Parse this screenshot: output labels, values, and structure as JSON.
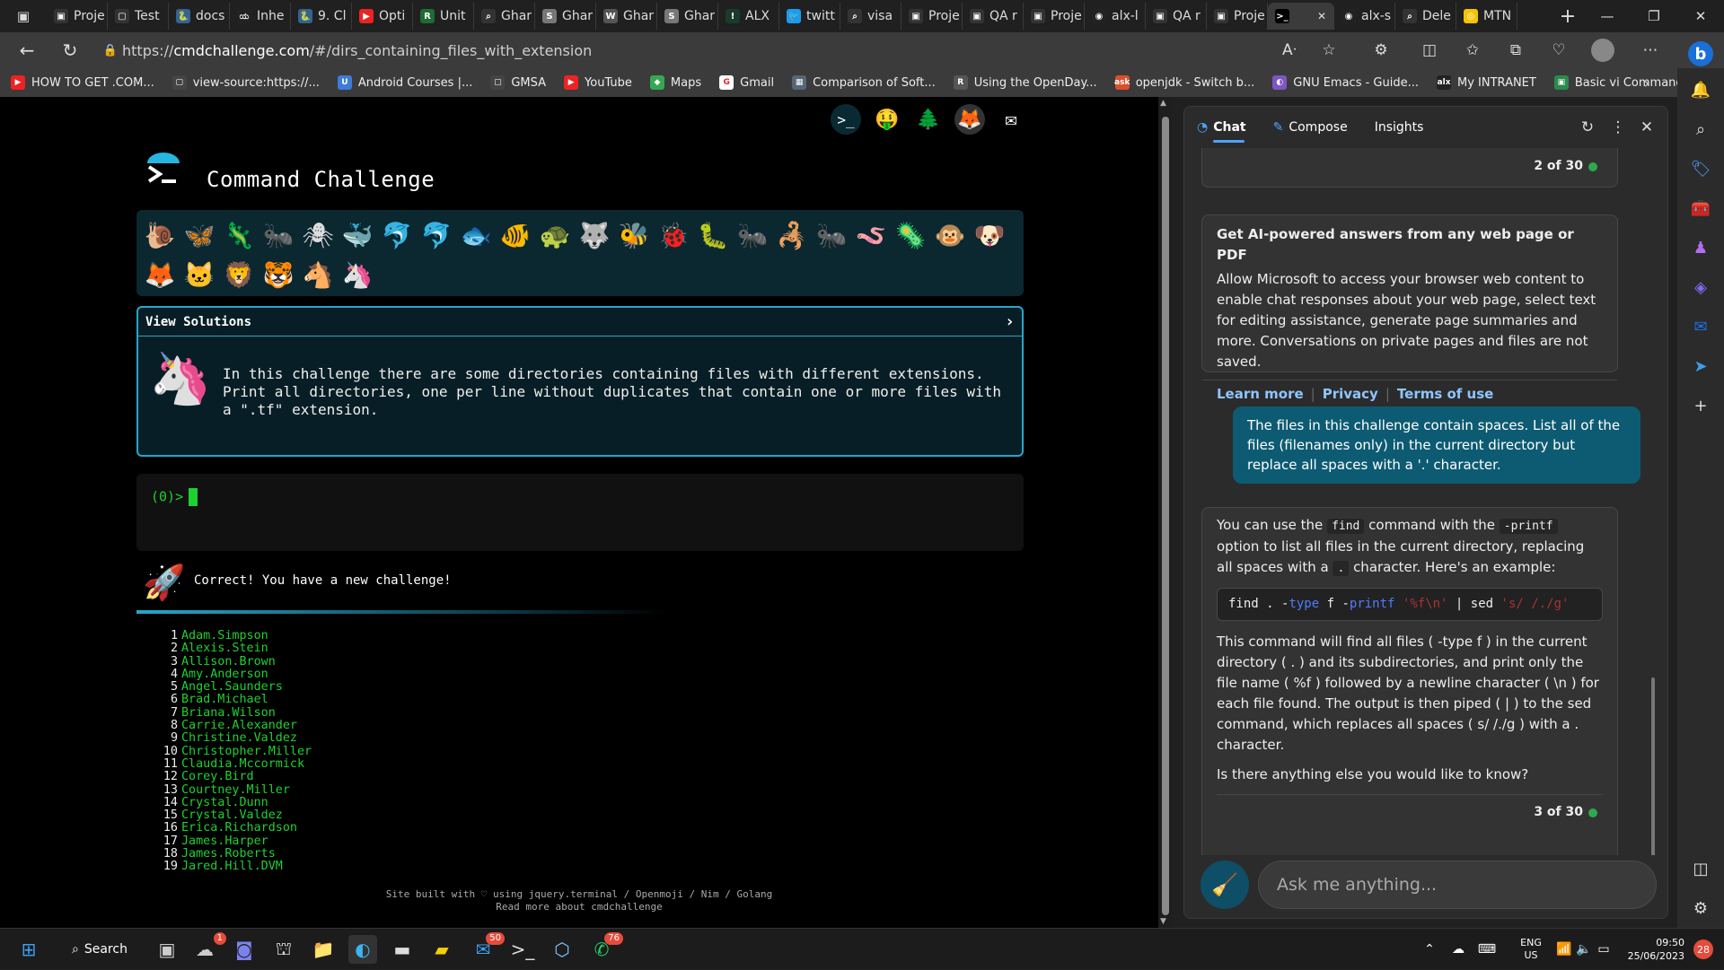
{
  "browser": {
    "tabs": [
      {
        "label": "Proje",
        "fav": "▣",
        "color": "#333"
      },
      {
        "label": "Test",
        "fav": "▢",
        "color": "#333"
      },
      {
        "label": "docs",
        "fav": "🐍",
        "color": "#35638f"
      },
      {
        "label": "Inhe",
        "fav": "ಯ",
        "color": "#222"
      },
      {
        "label": "9. Cl",
        "fav": "🐍",
        "color": "#35638f"
      },
      {
        "label": "Opti",
        "fav": "▶",
        "color": "#e22"
      },
      {
        "label": "Unit",
        "fav": "R",
        "color": "#1f6b34"
      },
      {
        "label": "Ghar",
        "fav": "⌕",
        "color": "#333"
      },
      {
        "label": "Ghar",
        "fav": "S",
        "color": "#777"
      },
      {
        "label": "Ghar",
        "fav": "W",
        "color": "#555"
      },
      {
        "label": "Ghar",
        "fav": "S",
        "color": "#777"
      },
      {
        "label": "ALX",
        "fav": "!",
        "color": "#1a3b2c"
      },
      {
        "label": "twitt",
        "fav": "🐦",
        "color": "#1d9bf0"
      },
      {
        "label": "visa",
        "fav": "⌕",
        "color": "#333"
      },
      {
        "label": "Proje",
        "fav": "▣",
        "color": "#333"
      },
      {
        "label": "QA r",
        "fav": "▣",
        "color": "#333"
      },
      {
        "label": "Proje",
        "fav": "▣",
        "color": "#333"
      },
      {
        "label": "alx-l",
        "fav": "◉",
        "color": "#222"
      },
      {
        "label": "QA r",
        "fav": "▣",
        "color": "#333"
      },
      {
        "label": "Proje",
        "fav": "▣",
        "color": "#333"
      },
      {
        "label": "",
        "fav": ">_",
        "color": "#000",
        "active": true
      },
      {
        "label": "alx-s",
        "fav": "◉",
        "color": "#222"
      },
      {
        "label": "Dele",
        "fav": "⌕",
        "color": "#333"
      },
      {
        "label": "MTN",
        "fav": "◎",
        "color": "#f5c400"
      }
    ],
    "url_scheme": "https://",
    "url_host": "cmdchallenge.com",
    "url_path": "/#/dirs_containing_files_with_extension",
    "bookmarks": [
      {
        "label": "HOW TO GET .COM...",
        "fav": "▶",
        "color": "#e22"
      },
      {
        "label": "view-source:https://...",
        "fav": "▢",
        "color": "#444"
      },
      {
        "label": "Android Courses |...",
        "fav": "U",
        "color": "#3d7bd8"
      },
      {
        "label": "GMSA",
        "fav": "▢",
        "color": "#444"
      },
      {
        "label": "YouTube",
        "fav": "▶",
        "color": "#e22"
      },
      {
        "label": "Maps",
        "fav": "◆",
        "color": "#34a853"
      },
      {
        "label": "Gmail",
        "fav": "G",
        "color": "#fff"
      },
      {
        "label": "Comparison of Soft...",
        "fav": "▦",
        "color": "#567"
      },
      {
        "label": "Using the OpenDay...",
        "fav": "R",
        "color": "#555"
      },
      {
        "label": "openjdk - Switch b...",
        "fav": "ask",
        "color": "#d9502c"
      },
      {
        "label": "GNU Emacs - Guide...",
        "fav": "◐",
        "color": "#7e57c2"
      },
      {
        "label": "My INTRANET",
        "fav": "alx",
        "color": "#222"
      },
      {
        "label": "Basic vi Commands",
        "fav": "▣",
        "color": "#2a8a4c"
      }
    ]
  },
  "page": {
    "title": "Command Challenge",
    "top_icons": [
      "terminal-icon",
      "donate-icon",
      "tree-icon",
      "gitlab-icon",
      "mail-icon"
    ],
    "animals": [
      "🐌",
      "🦋",
      "🦎",
      "🐜",
      "🕷",
      "🐳",
      "🐬",
      "🐬",
      "🐟",
      "🐠",
      "🐢",
      "🐺",
      "🐝",
      "🐞",
      "🐛",
      "🐜",
      "🦂",
      "🐜",
      "🪱",
      "🦠",
      "🐵",
      "🐶",
      "🦊",
      "🐱",
      "🦁",
      "🐯",
      "🐴",
      "🦄"
    ],
    "solutions_label": "View Solutions",
    "challenge_text": "In this challenge there are some directories containing files with different extensions. Print all directories, one per line without duplicates that contain one or more files with a \".tf\" extension.",
    "prompt": "(0)>",
    "correct_msg": "Correct! You have a new challenge!",
    "output": [
      {
        "n": "1",
        "v": "Adam.Simpson"
      },
      {
        "n": "2",
        "v": "Alexis.Stein"
      },
      {
        "n": "3",
        "v": "Allison.Brown"
      },
      {
        "n": "4",
        "v": "Amy.Anderson"
      },
      {
        "n": "5",
        "v": "Angel.Saunders"
      },
      {
        "n": "6",
        "v": "Brad.Michael"
      },
      {
        "n": "7",
        "v": "Briana.Wilson"
      },
      {
        "n": "8",
        "v": "Carrie.Alexander"
      },
      {
        "n": "9",
        "v": "Christine.Valdez"
      },
      {
        "n": "10",
        "v": "Christopher.Miller"
      },
      {
        "n": "11",
        "v": "Claudia.Mccormick"
      },
      {
        "n": "12",
        "v": "Corey.Bird"
      },
      {
        "n": "13",
        "v": "Courtney.Miller"
      },
      {
        "n": "14",
        "v": "Crystal.Dunn"
      },
      {
        "n": "15",
        "v": "Crystal.Valdez"
      },
      {
        "n": "16",
        "v": "Erica.Richardson"
      },
      {
        "n": "17",
        "v": "James.Harper"
      },
      {
        "n": "18",
        "v": "James.Roberts"
      },
      {
        "n": "19",
        "v": "Jared.Hill.DVM"
      }
    ],
    "footer_line1": "Site built with ♡ using jquery.terminal / Openmoji / Nim / Golang",
    "footer_line2": "Read more about cmdchallenge"
  },
  "chat": {
    "tabs": [
      "Chat",
      "Compose",
      "Insights"
    ],
    "count1": "2 of 30",
    "info_title": "Get AI-powered answers from any web page or PDF",
    "info_body": "Allow Microsoft to access your browser web content to enable chat responses about your web page, select text for editing assistance, generate page summaries and more. Conversations on private pages and files are not saved.",
    "links": [
      "Learn more",
      "Privacy",
      "Terms of use"
    ],
    "user_msg": "The files in this challenge contain spaces. List all of the files (filenames only) in the current directory but replace all spaces with a '.' character.",
    "reply_p1a": "You can use the",
    "reply_find": "find",
    "reply_p1b": "command with the",
    "reply_printf": "-printf",
    "reply_p1c": "option to list all files in the current directory, replacing all spaces with a",
    "reply_dot": ".",
    "reply_p1d": "character. Here's an example:",
    "code_find": "find . -",
    "code_type": "type",
    "code_f": "f -",
    "code_printf": "printf",
    "code_fmt": "'%f\\n'",
    "code_pipe": "| sed",
    "code_sed": "'s/ /./g'",
    "reply_p2": "This command will find all files ( -type f ) in the current directory ( . ) and its subdirectories, and print only the file name ( %f ) followed by a newline character ( \\n ) for each file found. The output is then piped ( | ) to the sed command, which replaces all spaces ( s/ /./g ) with a . character.",
    "reply_p3": "Is there anything else you would like to know?",
    "count2": "3 of 30",
    "input_placeholder": "Ask me anything..."
  },
  "taskbar": {
    "search_label": "Search",
    "badge_chat": "1",
    "badge_mail": "50",
    "badge_whatsapp": "76",
    "lang1": "ENG",
    "lang2": "US",
    "time": "09:50",
    "date": "25/06/2023",
    "notif": "28"
  }
}
